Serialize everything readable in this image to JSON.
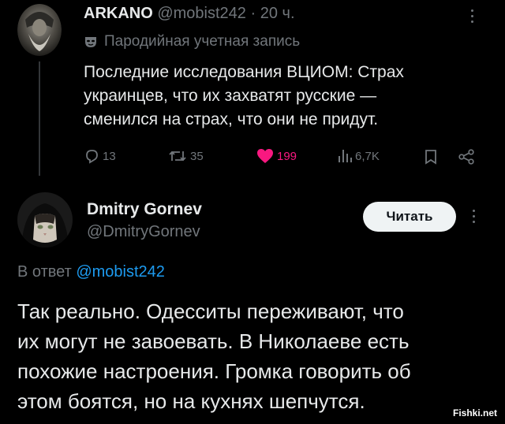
{
  "tweet1": {
    "display_name": "ARKANO",
    "handle": "@mobist242",
    "separator": "·",
    "time": "20 ч.",
    "parody_label": "Пародийная учетная запись",
    "text_lines": [
      "Последние исследования ВЦИОМ: Страх",
      "украинцев, что их захватят русские —",
      "сменился на страх, что они не придут."
    ],
    "replies": "13",
    "reposts": "35",
    "likes": "199",
    "views": "6,7K"
  },
  "tweet2": {
    "display_name": "Dmitry Gornev",
    "handle": "@DmitryGornev",
    "follow_label": "Читать",
    "reply_prefix": "В ответ",
    "reply_to": "@mobist242",
    "text_lines": [
      "Так реально. Одесситы переживают, что",
      "их могут не завоевать. В Николаеве есть",
      "похожие настроения. Громка говорить об",
      "этом боятся, но на кухнях шепчутся."
    ]
  },
  "watermark": "Fishki.net",
  "colors": {
    "like": "#f91880",
    "link": "#1d9bf0",
    "muted": "#71767b"
  },
  "icons": [
    "reply-icon",
    "repost-icon",
    "heart-icon",
    "views-icon",
    "bookmark-icon",
    "share-icon",
    "mask-icon",
    "more-icon"
  ]
}
